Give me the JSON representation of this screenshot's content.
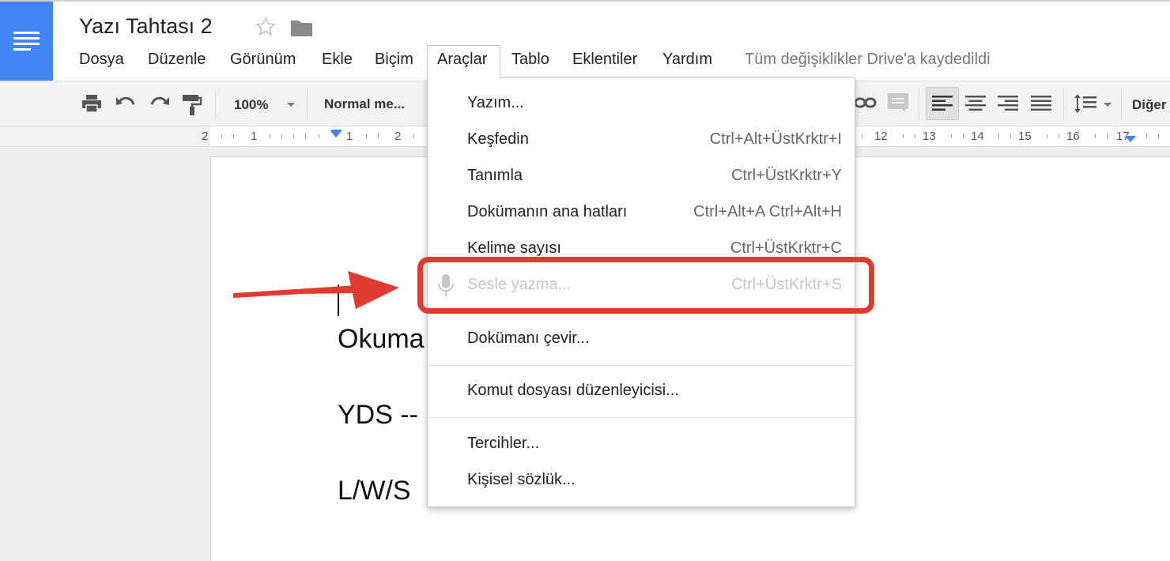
{
  "app": {
    "doc_title": "Yazı Tahtası 2",
    "save_status": "Tüm değişiklikler Drive'a kaydedildi",
    "accent_color": "#4285f4",
    "icons": [
      "docs-logo-icon",
      "star-icon",
      "folder-icon"
    ]
  },
  "menubar": {
    "items": [
      "Dosya",
      "Düzenle",
      "Görünüm",
      "Ekle",
      "Biçim",
      "Araçlar",
      "Tablo",
      "Eklentiler",
      "Yardım"
    ],
    "active": "Araçlar"
  },
  "toolbar": {
    "zoom": "100%",
    "style": "Normal me...",
    "more": "Diğer",
    "icons": [
      "print-icon",
      "undo-icon",
      "redo-icon",
      "paint-format-icon",
      "link-icon",
      "comment-icon",
      "align-left-icon",
      "align-center-icon",
      "align-right-icon",
      "align-justify-icon",
      "line-spacing-icon"
    ]
  },
  "ruler": {
    "left_labels": [
      "2",
      "1",
      "1",
      "2"
    ],
    "right_labels": [
      "12",
      "13",
      "14",
      "15",
      "16",
      "17"
    ]
  },
  "document": {
    "lines": [
      "Okuma",
      "YDS --",
      "L/W/S"
    ]
  },
  "tools_menu": {
    "items": [
      {
        "label": "Yazım...",
        "shortcut": ""
      },
      {
        "label": "Keşfedin",
        "shortcut": "Ctrl+Alt+ÜstKrktr+I"
      },
      {
        "label": "Tanımla",
        "shortcut": "Ctrl+ÜstKrktr+Y"
      },
      {
        "label": "Dokümanın ana hatları",
        "shortcut": "Ctrl+Alt+A Ctrl+Alt+H"
      },
      {
        "label": "Kelime sayısı",
        "shortcut": "Ctrl+ÜstKrktr+C"
      },
      {
        "label": "Sesle yazma...",
        "shortcut": "Ctrl+ÜstKrktr+S",
        "icon": "microphone-icon",
        "disabled": true
      },
      {
        "label": "Dokümanı çevir...",
        "shortcut": ""
      },
      {
        "label": "Komut dosyası düzenleyicisi...",
        "shortcut": ""
      },
      {
        "label": "Tercihler...",
        "shortcut": ""
      },
      {
        "label": "Kişisel sözlük...",
        "shortcut": ""
      }
    ]
  },
  "annotation": {
    "color": "#e03b30",
    "highlighted_item": "Sesle yazma..."
  }
}
